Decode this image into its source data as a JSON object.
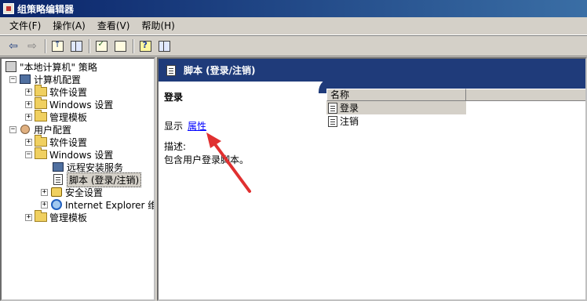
{
  "window": {
    "title": "组策略编辑器"
  },
  "menu": [
    {
      "label": "文件(F)"
    },
    {
      "label": "操作(A)"
    },
    {
      "label": "查看(V)"
    },
    {
      "label": "帮助(H)"
    }
  ],
  "toolbar": {
    "back_icon": "back-arrow-icon",
    "forward_icon": "forward-arrow-icon"
  },
  "tree": {
    "root": "\"本地计算机\" 策略",
    "computer_config": "计算机配置",
    "cc_software": "软件设置",
    "cc_windows": "Windows 设置",
    "cc_admin": "管理模板",
    "user_config": "用户配置",
    "uc_software": "软件设置",
    "uc_windows": "Windows 设置",
    "uc_ris": "远程安装服务",
    "uc_scripts": "脚本 (登录/注销)",
    "uc_security": "安全设置",
    "uc_ie": "Internet Explorer 维护",
    "uc_admin": "管理模板"
  },
  "detail": {
    "header_title": "脚本 (登录/注销)",
    "item_title": "登录",
    "show_label": "显示",
    "properties_link": "属性",
    "description_label": "描述:",
    "description_text": "包含用户登录脚本。"
  },
  "list": {
    "column_name": "名称",
    "rows": [
      {
        "label": "登录"
      },
      {
        "label": "注销"
      }
    ]
  },
  "colors": {
    "header_bg": "#1f3b7a",
    "link": "#0000ff",
    "annotation_arrow": "#e03030"
  }
}
